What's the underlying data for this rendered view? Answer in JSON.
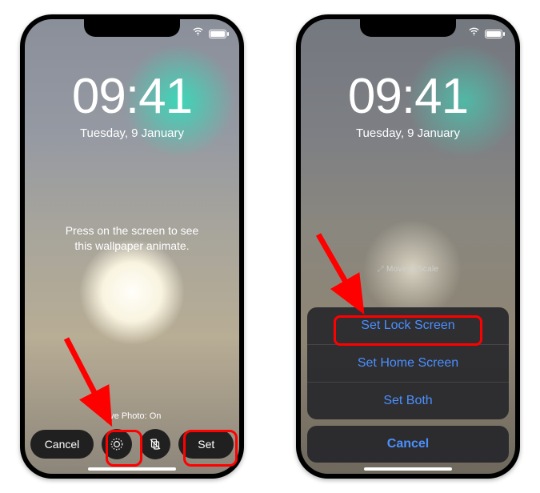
{
  "status": {
    "wifi": "wifi",
    "battery": "full"
  },
  "clock": {
    "time": "09:41",
    "date": "Tuesday, 9 January"
  },
  "left": {
    "instruction_l1": "Press on the screen to see",
    "instruction_l2": "this wallpaper animate.",
    "live_photo_label": "Live Photo: On",
    "cancel": "Cancel",
    "set": "Set"
  },
  "right": {
    "move_scale": "Move & Scale",
    "sheet": {
      "lock": "Set Lock Screen",
      "home": "Set Home Screen",
      "both": "Set Both",
      "cancel": "Cancel"
    }
  }
}
